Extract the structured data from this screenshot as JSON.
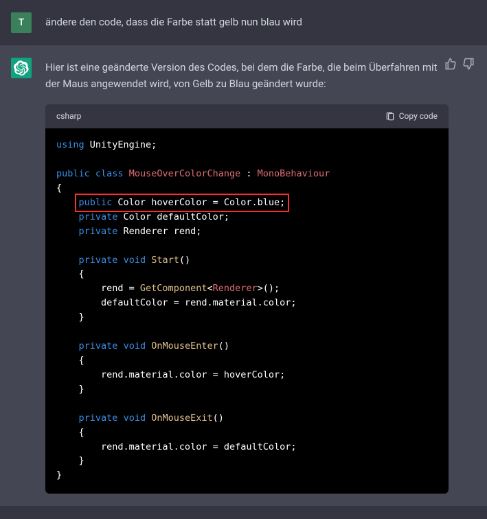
{
  "user": {
    "avatar_letter": "T",
    "message": "ändere den code, dass die Farbe statt gelb nun blau wird"
  },
  "assistant": {
    "intro": "Hier ist eine geänderte Version des Codes, bei dem die Farbe, die beim Überfahren mit der Maus angewendet wird, von Gelb zu Blau geändert wurde:",
    "code_lang": "csharp",
    "copy_label": "Copy code",
    "code": {
      "l1_kw": "using",
      "l1_rest": " UnityEngine;",
      "l3_kw1": "public",
      "l3_kw2": "class",
      "l3_cls": "MouseOverColorChange",
      "l3_colon": " : ",
      "l3_base": "MonoBehaviour",
      "l5_kw": "public",
      "l5_rest": " Color hoverColor = Color.blue;",
      "l6_kw": "private",
      "l6_rest": " Color defaultColor;",
      "l7_kw": "private",
      "l7_rest": " Renderer rend;",
      "l9_kw1": "private",
      "l9_kw2": "void",
      "l9_m": "Start",
      "l9_p": "()",
      "l11": "        rend = GetComponent<Renderer>();",
      "l11_a": "        rend = ",
      "l11_m": "GetComponent",
      "l11_b": "<",
      "l11_t": "Renderer",
      "l11_c": ">();",
      "l12": "        defaultColor = rend.material.color;",
      "l15_kw1": "private",
      "l15_kw2": "void",
      "l15_m": "OnMouseEnter",
      "l15_p": "()",
      "l17": "        rend.material.color = hoverColor;",
      "l20_kw1": "private",
      "l20_kw2": "void",
      "l20_m": "OnMouseExit",
      "l20_p": "()",
      "l22": "        rend.material.color = defaultColor;"
    }
  }
}
